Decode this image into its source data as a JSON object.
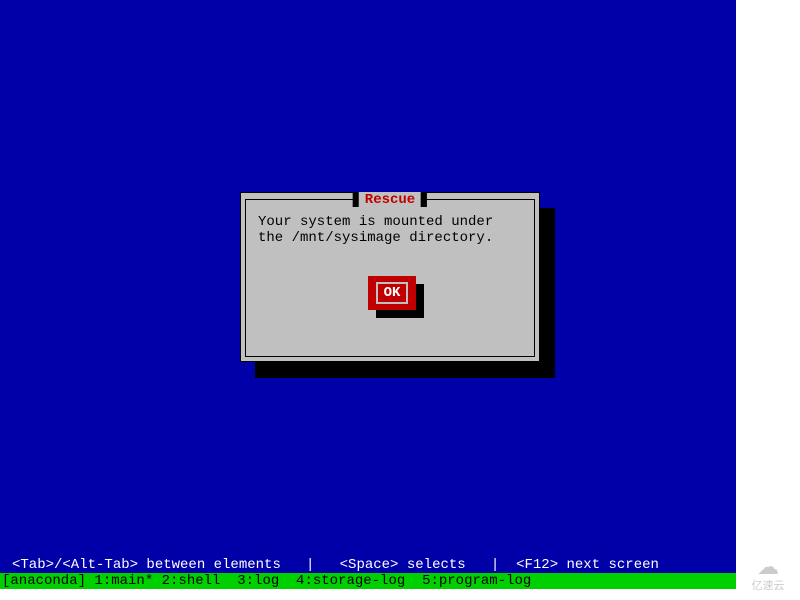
{
  "dialog": {
    "title": "Rescue",
    "message": "Your system is mounted under the /mnt/sysimage directory.",
    "ok_label": "OK"
  },
  "help_bar": "<Tab>/<Alt-Tab> between elements   |   <Space> selects   |  <F12> next screen",
  "status_bar": "[anaconda] 1:main* 2:shell  3:log  4:storage-log  5:program-log",
  "watermark": "亿速云",
  "colors": {
    "background": "#0000a8",
    "dialog_bg": "#c0c0c0",
    "accent_red": "#c00000",
    "status_green": "#00d000"
  }
}
